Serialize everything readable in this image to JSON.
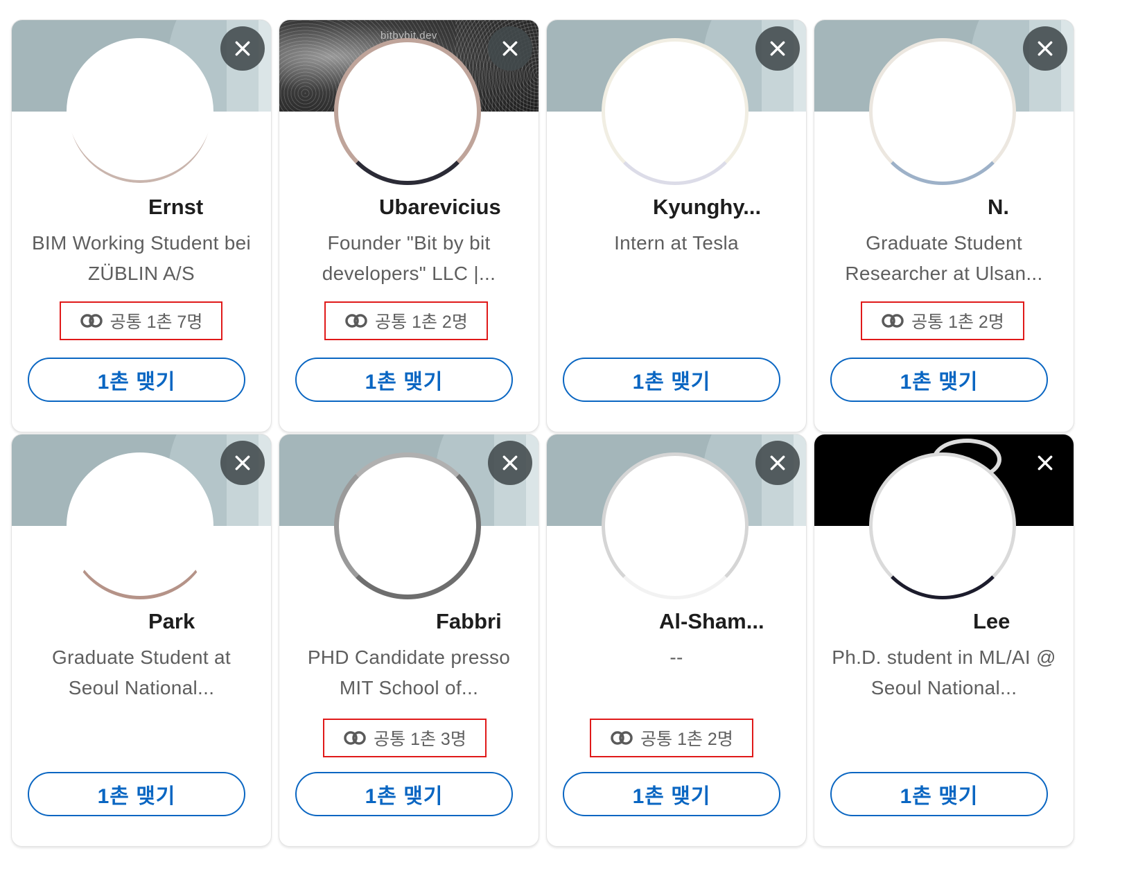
{
  "cards": [
    {
      "name": "Ernst",
      "headline": "BIM Working Student bei ZÜBLIN A/S",
      "mutual": "공통 1촌 7명",
      "connect": "1촌 맺기"
    },
    {
      "name": "Ubarevicius",
      "banner_text": "bitbybit.dev",
      "headline": "Founder \"Bit by bit developers\" LLC |...",
      "mutual": "공통 1촌 2명",
      "connect": "1촌 맺기"
    },
    {
      "name": "Kyunghy...",
      "headline": "Intern at Tesla",
      "connect": "1촌 맺기"
    },
    {
      "name": "N.",
      "headline": "Graduate Student Researcher at Ulsan...",
      "mutual": "공통 1촌 2명",
      "connect": "1촌 맺기"
    },
    {
      "name": "Park",
      "headline": "Graduate Student at Seoul National...",
      "connect": "1촌 맺기"
    },
    {
      "name": "Fabbri",
      "headline": "PHD Candidate presso MIT School of...",
      "mutual": "공통 1촌 3명",
      "connect": "1촌 맺기"
    },
    {
      "name": "Al-Sham...",
      "headline": "--",
      "mutual": "공통 1촌 2명",
      "connect": "1촌 맺기"
    },
    {
      "name": "Lee",
      "headline": "Ph.D. student in ML/AI @ Seoul National...",
      "connect": "1촌 맺기"
    }
  ],
  "icons": {
    "close": "close-icon",
    "mutual": "mutual-connections-icon"
  },
  "colors": {
    "accent": "#0a66c2",
    "highlight_box": "#e01919",
    "banner": "#a4b6ba",
    "close_bg": "#424a4c"
  }
}
